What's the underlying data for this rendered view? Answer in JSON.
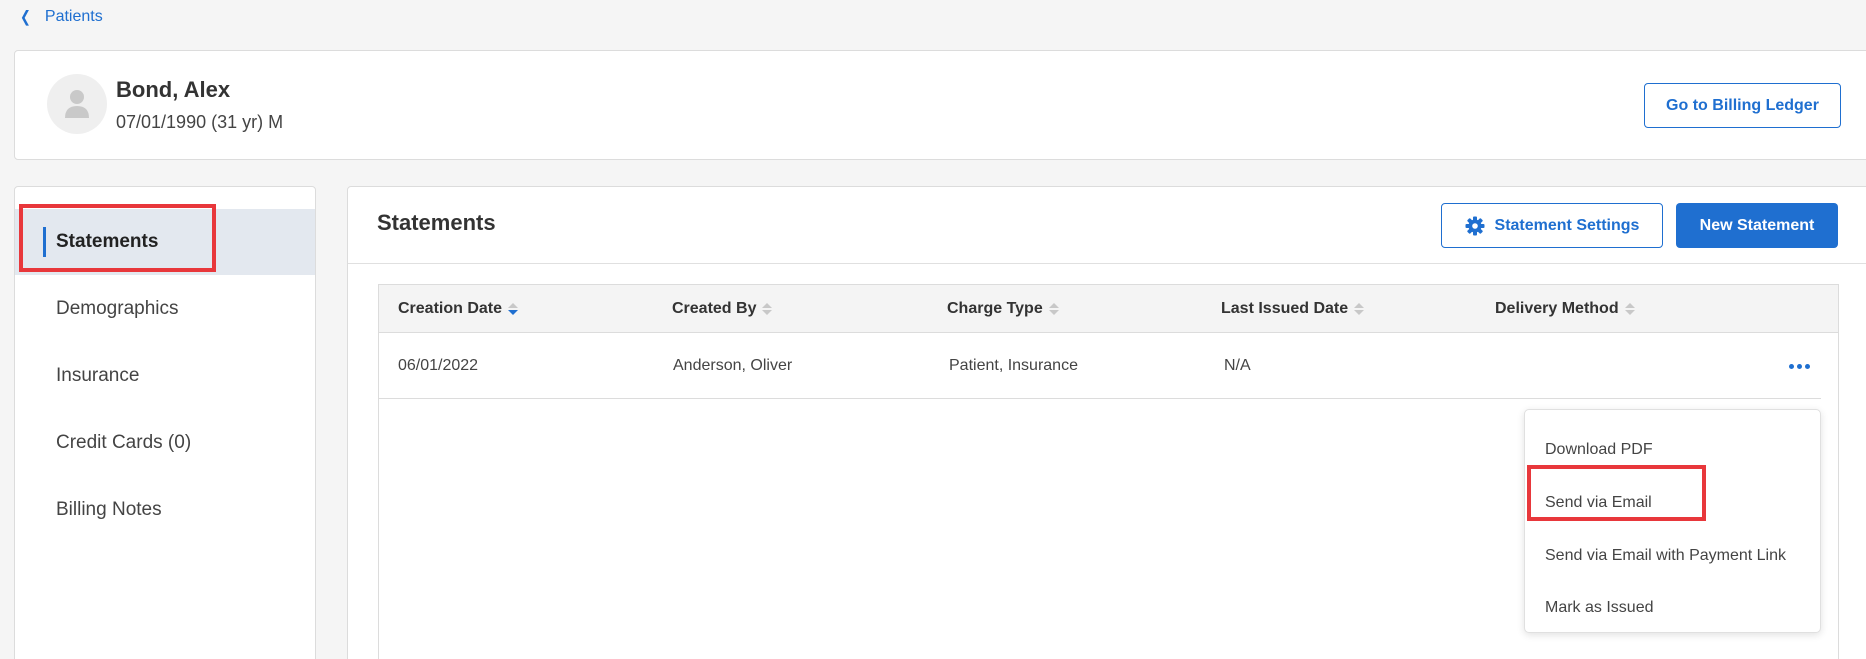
{
  "breadcrumb": {
    "label": "Patients"
  },
  "patient": {
    "name": "Bond, Alex",
    "dob_line": "07/01/1990 (31 yr) M",
    "billing_ledger_button": "Go to Billing Ledger"
  },
  "sidebar": {
    "items": [
      {
        "label": "Statements",
        "active": true
      },
      {
        "label": "Demographics"
      },
      {
        "label": "Insurance"
      },
      {
        "label": "Credit Cards (0)"
      },
      {
        "label": "Billing Notes"
      }
    ]
  },
  "main": {
    "title": "Statements",
    "settings_button": "Statement Settings",
    "new_button": "New Statement"
  },
  "table": {
    "columns": [
      "Creation Date",
      "Created By",
      "Charge Type",
      "Last Issued Date",
      "Delivery Method"
    ],
    "sorted_column": "Creation Date",
    "rows": [
      {
        "creation_date": "06/01/2022",
        "created_by": "Anderson, Oliver",
        "charge_type": "Patient, Insurance",
        "last_issued": "N/A",
        "delivery_method": ""
      }
    ]
  },
  "menu": {
    "items": [
      "Download PDF",
      "Send via Email",
      "Send via Email with Payment Link",
      "Mark as Issued"
    ]
  },
  "colors": {
    "accent": "#1f6fd0",
    "highlight": "#e8373b",
    "active_sidebar_bg": "#e3e8ef"
  }
}
